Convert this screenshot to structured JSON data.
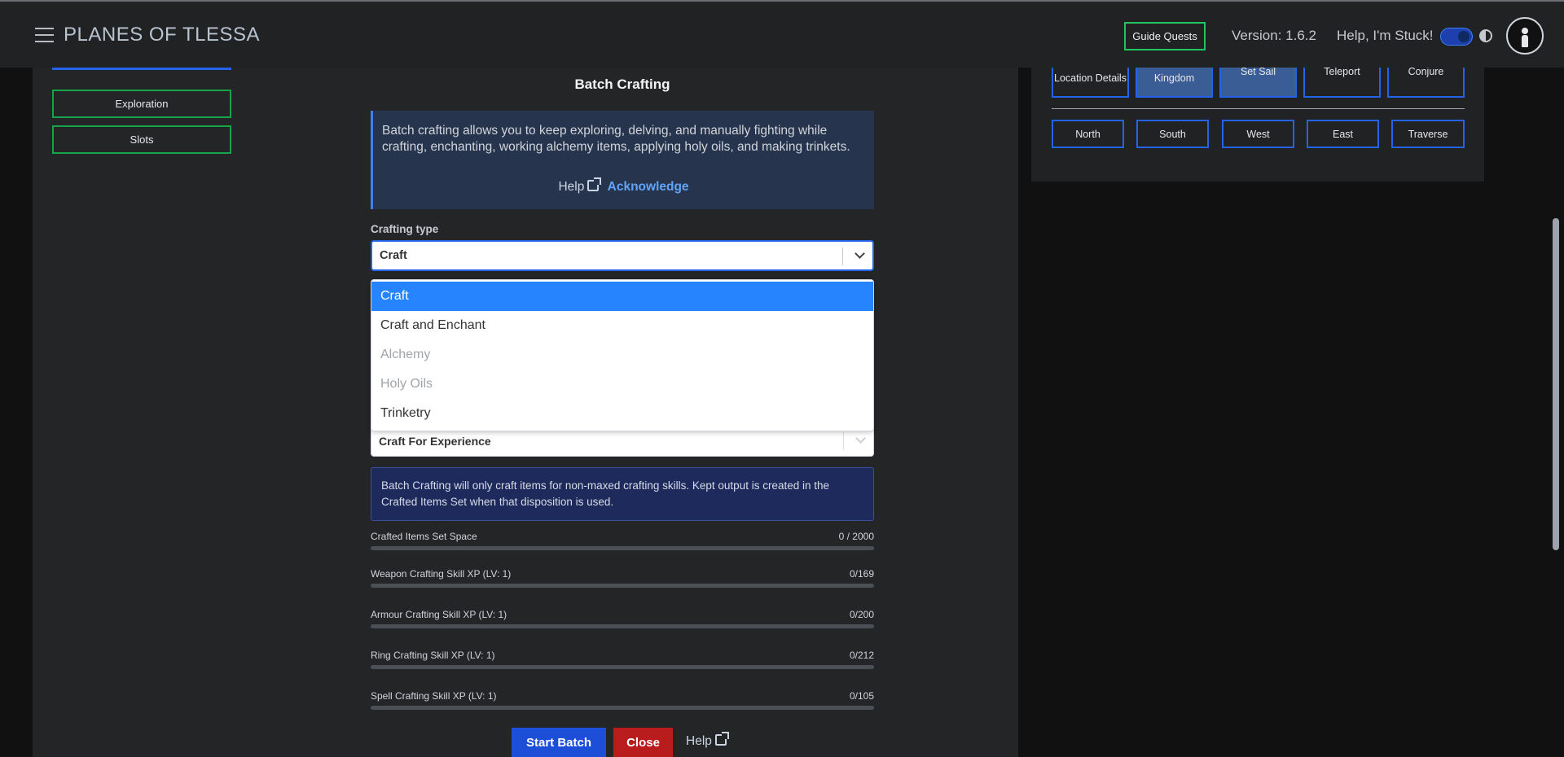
{
  "header": {
    "brand": "PLANES OF TLESSA",
    "guide_quests": "Guide Quests",
    "version": "Version: 1.6.2",
    "help_stuck": "Help, I'm Stuck!"
  },
  "sidebar": {
    "exploration": "Exploration",
    "slots": "Slots"
  },
  "map_actions": {
    "location_details": "Location Details",
    "kingdom": "Kingdom",
    "set_sail": "Set Sail",
    "teleport": "Teleport",
    "conjure": "Conjure",
    "north": "North",
    "south": "South",
    "west": "West",
    "east": "East",
    "traverse": "Traverse"
  },
  "modal": {
    "title": "Batch Crafting",
    "info_text": "Batch crafting allows you to keep exploring, delving, and manually fighting while crafting, enchanting, working alchemy items, applying holy oils, and making trinkets.",
    "info_help": "Help",
    "acknowledge": "Acknowledge",
    "crafting_type_label": "Crafting type",
    "crafting_type_value": "Craft",
    "crafting_options": [
      {
        "label": "Craft",
        "selected": true,
        "disabled": false
      },
      {
        "label": "Craft and Enchant",
        "selected": false,
        "disabled": false
      },
      {
        "label": "Alchemy",
        "selected": false,
        "disabled": true
      },
      {
        "label": "Holy Oils",
        "selected": false,
        "disabled": true
      },
      {
        "label": "Trinketry",
        "selected": false,
        "disabled": false
      }
    ],
    "disposition_value": "Craft For Experience",
    "note": "Batch Crafting will only craft items for non-maxed crafting skills. Kept output is created in the Crafted Items Set when that disposition is used.",
    "bars": [
      {
        "label": "Crafted Items Set Space",
        "value": "0 / 2000",
        "fraction": 0
      },
      {
        "label": "Weapon Crafting Skill XP (LV: 1)",
        "value": "0/169",
        "fraction": 0
      },
      {
        "label": "Armour Crafting Skill XP (LV: 1)",
        "value": "0/200",
        "fraction": 0
      },
      {
        "label": "Ring Crafting Skill XP (LV: 1)",
        "value": "0/212",
        "fraction": 0
      },
      {
        "label": "Spell Crafting Skill XP (LV: 1)",
        "value": "0/105",
        "fraction": 0
      }
    ],
    "start_batch": "Start Batch",
    "close": "Close",
    "help": "Help"
  },
  "icons": [
    "hamburger-icon",
    "contrast-icon",
    "avatar-icon",
    "external-link-icon",
    "chevron-down-icon"
  ]
}
